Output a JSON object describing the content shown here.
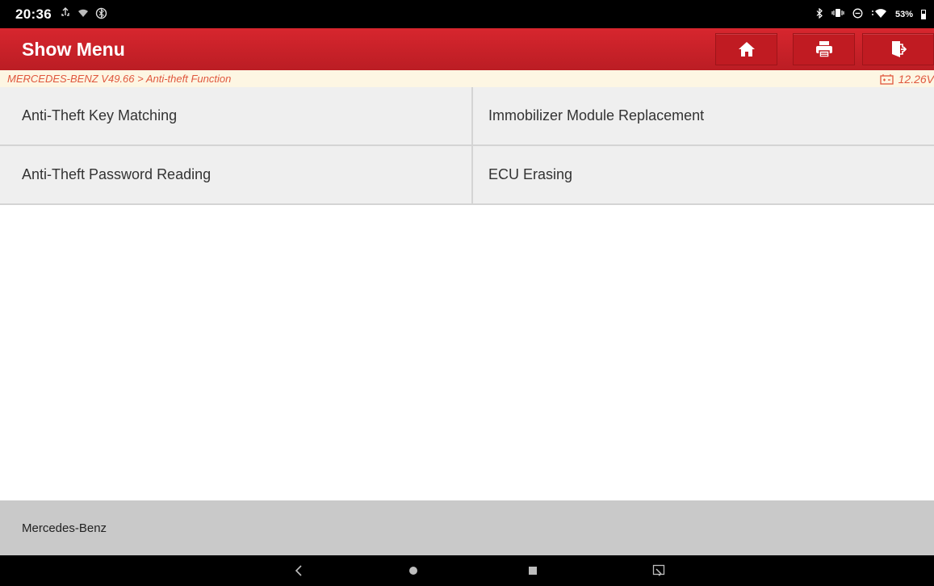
{
  "status_bar": {
    "time": "20:36",
    "battery": "53%"
  },
  "header": {
    "title": "Show Menu",
    "buttons": {
      "home_icon": "home-icon",
      "print_icon": "printer-icon",
      "exit_icon": "exit-icon"
    }
  },
  "breadcrumb": {
    "path": "MERCEDES-BENZ V49.66 > Anti-theft Function",
    "voltage": "12.26V"
  },
  "menu": {
    "items": [
      "Anti-Theft Key Matching",
      "Immobilizer Module Replacement",
      "Anti-Theft Password Reading",
      "ECU Erasing"
    ]
  },
  "footer": {
    "text": "Mercedes-Benz"
  },
  "nav_bar": {
    "back_icon": "back-icon",
    "home_icon": "home-circle-icon",
    "recents_icon": "recents-icon",
    "screenshot_icon": "screenshot-icon"
  },
  "colors": {
    "header_red": "#c8212a",
    "breadcrumb_text": "#e0573d",
    "breadcrumb_bg": "#fdf6e3",
    "menu_bg": "#efefef",
    "footer_bg": "#c9c9c9"
  }
}
